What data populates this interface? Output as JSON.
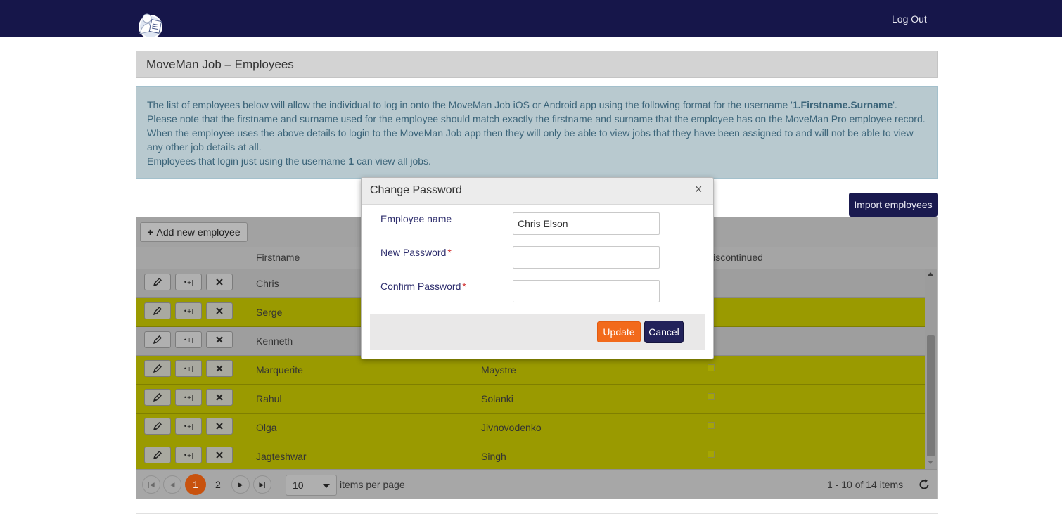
{
  "nav": {
    "logout_label": "Log Out"
  },
  "page": {
    "title": "MoveMan Job – Employees"
  },
  "info": {
    "line1_pre": "The list of employees below will allow the individual to log in onto the MoveMan Job iOS or Android app using the following format for the username '",
    "line1_bold": "1.Firstname.Surname",
    "line1_post": "'.",
    "line2": "Please note that the firstname and surname used for the employee should match exactly the firstname and surname that the employee has on the MoveMan Pro employee record.",
    "line3": "When the employee uses the above details to login to the MoveMan Job app then they will only be able to view jobs that they have been assigned to and will not be able to view",
    "line4": "any other job details at all.",
    "line5_pre": "Employees that login just using the username ",
    "line5_bold": "1",
    "line5_post": " can view all jobs."
  },
  "toolbar": {
    "import_label": "Import employees",
    "add_label": "Add new employee"
  },
  "grid": {
    "headers": [
      "",
      "Firstname",
      "",
      "Discontinued"
    ],
    "rows": [
      {
        "first": "Chris",
        "last": "",
        "style": "grey"
      },
      {
        "first": "Serge",
        "last": "",
        "style": "yellow"
      },
      {
        "first": "Kenneth",
        "last": "",
        "style": "grey"
      },
      {
        "first": "Marquerite",
        "last": "Maystre",
        "style": "yellow"
      },
      {
        "first": "Rahul",
        "last": "Solanki",
        "style": "yellow"
      },
      {
        "first": "Olga",
        "last": "Jivnovodenko",
        "style": "yellow"
      },
      {
        "first": "Jagteshwar",
        "last": "Singh",
        "style": "yellow"
      }
    ],
    "icons": {
      "edit": "pencil-icon",
      "reset": "reset-password-icon",
      "delete": "delete-icon"
    }
  },
  "pager": {
    "pages": [
      "1",
      "2"
    ],
    "current": "1",
    "page_size": "10",
    "items_label": "items per page",
    "info": "1 - 10 of 14 items"
  },
  "modal": {
    "title": "Change Password",
    "close": "×",
    "employee_label": "Employee name",
    "employee_value": "Chris Elson",
    "new_password_label": "New Password",
    "confirm_password_label": "Confirm Password",
    "required_mark": "*",
    "update_label": "Update",
    "cancel_label": "Cancel"
  },
  "colors": {
    "navbar": "#16164a",
    "accent_orange": "#f26a1b",
    "cancel_navy": "#22225a",
    "row_highlight": "#9a9a00"
  }
}
